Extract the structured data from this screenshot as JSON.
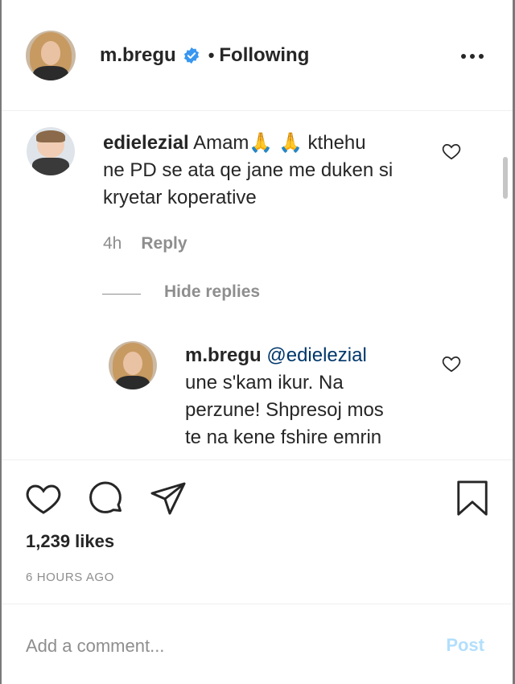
{
  "header": {
    "username": "m.bregu",
    "separator": "•",
    "follow_status": "Following",
    "verified_color": "#3897f0"
  },
  "comments": [
    {
      "username": "edielezial",
      "text_part1": "Amam",
      "emoji": "🙏",
      "text_part2": "kthehu",
      "line2": "ne PD se ata qe jane me duken si",
      "line3": "kryetar koperative",
      "time": "4h",
      "reply_label": "Reply"
    }
  ],
  "hide_replies_label": "Hide replies",
  "reply": {
    "username": "m.bregu",
    "mention": "@edielezial",
    "line1": "une s'kam ikur. Na",
    "line2": "perzune! Shpresoj mos",
    "line3": "te na kene fshire emrin"
  },
  "post": {
    "likes": "1,239 likes",
    "time_ago": "6 HOURS AGO"
  },
  "composer": {
    "placeholder": "Add a comment...",
    "post_label": "Post",
    "post_color": "#b2dffc"
  },
  "icons": [
    "verified-badge-icon",
    "more-options-icon",
    "heart-icon",
    "comment-icon",
    "share-icon",
    "bookmark-icon"
  ]
}
